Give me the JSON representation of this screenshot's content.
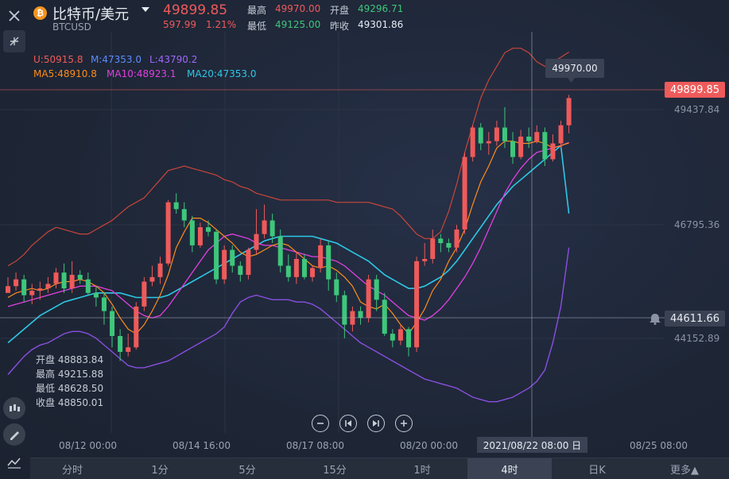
{
  "header": {
    "coin_glyph": "₿",
    "title": "比特币/美元",
    "symbol": "BTCUSD",
    "price": "49899.85",
    "change": "597.99",
    "change_pct": "1.21%",
    "high_label": "最高",
    "high_value": "49970.00",
    "open_label": "开盘",
    "open_value": "49296.71",
    "low_label": "最低",
    "low_value": "49125.00",
    "prev_label": "昨收",
    "prev_value": "49301.86"
  },
  "indicators": {
    "boll_u": "U:50915.8",
    "boll_m": "M:47353.0",
    "boll_l": "L:43790.2",
    "ma5": "MA5:48910.8",
    "ma10": "MA10:48923.1",
    "ma20": "MA20:47353.0"
  },
  "colors": {
    "up": "#ef5a5a",
    "down": "#3ec77b",
    "ma5": "#ff8c1a",
    "ma10": "#e040e0",
    "ma20": "#2ec7e6",
    "boll_u": "#c8463a",
    "boll_l": "#8a4fe0",
    "boll_m": "#4a7cff"
  },
  "y_axis": {
    "ticks": [
      "49437.84",
      "46795.36",
      "44152.89"
    ],
    "current_price_tag": "49899.85",
    "crosshair_tag": "44611.66",
    "tooltip_high": "49970.00"
  },
  "ohlc_panel": {
    "open": "开盘 48883.84",
    "high": "最高 49215.88",
    "low": "最低 48628.50",
    "close": "收盘 48850.01"
  },
  "x_axis": {
    "ticks": [
      "08/12 00:00",
      "08/14 16:00",
      "08/17 08:00",
      "08/20 00:00",
      "08/25 08:00"
    ],
    "crosshair_label": "2021/08/22 08:00 日"
  },
  "tabs": [
    "分时",
    "1分",
    "5分",
    "15分",
    "1时",
    "4时",
    "日K",
    "更多▲"
  ],
  "active_tab": "4时",
  "icons": [
    "close-icon",
    "collapse-icon",
    "candle-style-icon",
    "draw-pen-icon",
    "indicator-icon",
    "zoom-out-icon",
    "first-page-icon",
    "last-page-icon",
    "zoom-in-icon",
    "bell-icon"
  ],
  "chart_data": {
    "type": "candlestick",
    "ylim": [
      43300,
      51100
    ],
    "candles": [
      [
        45600,
        45750,
        45700,
        45950
      ],
      [
        45750,
        45900,
        45650,
        46050
      ],
      [
        45900,
        45550,
        45400,
        46000
      ],
      [
        45550,
        45650,
        45350,
        45800
      ],
      [
        45650,
        45700,
        45450,
        45850
      ],
      [
        45700,
        45800,
        45600,
        45950
      ],
      [
        45800,
        46050,
        45700,
        46150
      ],
      [
        46050,
        45700,
        45600,
        46250
      ],
      [
        45700,
        46000,
        45600,
        46300
      ],
      [
        46000,
        45900,
        45800,
        46100
      ],
      [
        45900,
        45600,
        45550,
        46050
      ],
      [
        45600,
        45500,
        45300,
        45750
      ],
      [
        45500,
        45200,
        44900,
        45600
      ],
      [
        45200,
        44650,
        44400,
        45300
      ],
      [
        44650,
        44300,
        44100,
        44800
      ],
      [
        44300,
        44400,
        44200,
        44700
      ],
      [
        44400,
        45300,
        44350,
        45400
      ],
      [
        45300,
        45850,
        45200,
        45950
      ],
      [
        45850,
        45950,
        45750,
        46200
      ],
      [
        45950,
        46250,
        45800,
        46400
      ],
      [
        46250,
        47600,
        46200,
        47650
      ],
      [
        47600,
        47450,
        47350,
        47800
      ],
      [
        47450,
        47200,
        47050,
        47600
      ],
      [
        47200,
        46650,
        46500,
        47300
      ],
      [
        46650,
        47050,
        46600,
        47150
      ],
      [
        47050,
        46950,
        46850,
        47200
      ],
      [
        46950,
        45900,
        45800,
        47000
      ],
      [
        45900,
        46550,
        45800,
        46650
      ],
      [
        46550,
        46200,
        46050,
        46650
      ],
      [
        46200,
        46000,
        45850,
        46300
      ],
      [
        46000,
        46550,
        45900,
        46600
      ],
      [
        46550,
        46900,
        46450,
        47450
      ],
      [
        46900,
        47200,
        46800,
        47550
      ],
      [
        47200,
        46850,
        46700,
        47350
      ],
      [
        46850,
        46200,
        46050,
        47000
      ],
      [
        46200,
        45950,
        45850,
        46450
      ],
      [
        45950,
        46350,
        45800,
        46500
      ],
      [
        46350,
        45950,
        45900,
        46450
      ],
      [
        45950,
        46150,
        45850,
        46200
      ],
      [
        46150,
        46650,
        46050,
        46800
      ],
      [
        46650,
        45900,
        45650,
        46750
      ],
      [
        45900,
        45550,
        45400,
        46050
      ],
      [
        45550,
        44900,
        44600,
        45650
      ],
      [
        44900,
        45200,
        44750,
        45300
      ],
      [
        45200,
        45050,
        44900,
        45300
      ],
      [
        45050,
        45900,
        44950,
        46000
      ],
      [
        45900,
        45450,
        45200,
        46000
      ],
      [
        45450,
        44700,
        44650,
        45600
      ],
      [
        44700,
        44550,
        44400,
        44800
      ],
      [
        44550,
        44800,
        44450,
        44900
      ],
      [
        44800,
        44400,
        44200,
        44850
      ],
      [
        44400,
        46300,
        44300,
        46400
      ],
      [
        46300,
        46350,
        46200,
        46700
      ],
      [
        46350,
        46800,
        46250,
        47000
      ],
      [
        46800,
        46700,
        46500,
        46900
      ],
      [
        46700,
        46600,
        46500,
        46800
      ],
      [
        46600,
        47000,
        46500,
        47100
      ],
      [
        47000,
        48600,
        46900,
        48700
      ],
      [
        48600,
        49250,
        48500,
        49300
      ],
      [
        49250,
        48900,
        48750,
        49350
      ],
      [
        48900,
        48950,
        48650,
        49150
      ],
      [
        48950,
        49250,
        48850,
        49400
      ],
      [
        49250,
        48950,
        48800,
        49700
      ],
      [
        48950,
        48600,
        48450,
        49150
      ],
      [
        48600,
        49050,
        48550,
        49200
      ],
      [
        49050,
        48950,
        48800,
        49250
      ],
      [
        48950,
        49150,
        48900,
        49300
      ],
      [
        49150,
        48550,
        48400,
        49250
      ],
      [
        48550,
        48900,
        48500,
        49100
      ],
      [
        48900,
        49300,
        48800,
        49400
      ],
      [
        49300,
        49900,
        49125,
        49970
      ]
    ],
    "ma5": [
      45500,
      45600,
      45650,
      45700,
      45650,
      45700,
      45800,
      45850,
      45850,
      45900,
      45850,
      45750,
      45600,
      45350,
      45050,
      44800,
      44700,
      44900,
      45200,
      45550,
      46000,
      46600,
      46950,
      47250,
      47250,
      47150,
      47000,
      46850,
      46700,
      46500,
      46400,
      46450,
      46550,
      46650,
      46700,
      46650,
      46500,
      46350,
      46200,
      46150,
      46200,
      46100,
      45950,
      45750,
      45400,
      45300,
      45250,
      45350,
      45150,
      44900,
      44700,
      44950,
      45250,
      45650,
      45900,
      46300,
      46600,
      47000,
      47550,
      48050,
      48400,
      48800,
      48950,
      48950,
      48900,
      48900,
      48950,
      48900,
      48800,
      48850,
      48910
    ],
    "ma10": [
      45300,
      45350,
      45400,
      45450,
      45500,
      45550,
      45600,
      45650,
      45700,
      45750,
      45750,
      45750,
      45700,
      45650,
      45500,
      45350,
      45200,
      45100,
      45050,
      45100,
      45300,
      45550,
      45800,
      46050,
      46300,
      46550,
      46700,
      46850,
      46900,
      46850,
      46800,
      46700,
      46650,
      46650,
      46600,
      46550,
      46500,
      46450,
      46400,
      46400,
      46350,
      46300,
      46200,
      46050,
      45900,
      45750,
      45650,
      45550,
      45400,
      45250,
      45100,
      45050,
      45000,
      45100,
      45250,
      45450,
      45700,
      45950,
      46250,
      46600,
      47000,
      47400,
      47800,
      48100,
      48350,
      48550,
      48700,
      48750,
      48800,
      48850,
      48920
    ],
    "ma20": [
      44500,
      44650,
      44800,
      44950,
      45100,
      45200,
      45300,
      45400,
      45450,
      45500,
      45550,
      45600,
      45600,
      45600,
      45600,
      45550,
      45500,
      45500,
      45500,
      45500,
      45550,
      45650,
      45750,
      45850,
      45950,
      46050,
      46150,
      46250,
      46350,
      46450,
      46550,
      46650,
      46750,
      46800,
      46850,
      46850,
      46850,
      46850,
      46850,
      46800,
      46750,
      46700,
      46600,
      46500,
      46400,
      46300,
      46150,
      46000,
      45900,
      45800,
      45700,
      45700,
      45750,
      45850,
      45950,
      46100,
      46300,
      46550,
      46800,
      47050,
      47300,
      47550,
      47750,
      47950,
      48100,
      48250,
      48400,
      48550,
      48700,
      48850,
      47353
    ],
    "boll_u": [
      46200,
      46300,
      46450,
      46650,
      46800,
      46950,
      47050,
      47000,
      46950,
      46900,
      46900,
      47000,
      47100,
      47200,
      47350,
      47500,
      47600,
      47700,
      47900,
      48100,
      48300,
      48350,
      48400,
      48350,
      48300,
      48250,
      48200,
      48100,
      48050,
      47950,
      47900,
      47800,
      47750,
      47700,
      47650,
      47650,
      47650,
      47650,
      47650,
      47650,
      47650,
      47600,
      47600,
      47600,
      47600,
      47600,
      47550,
      47500,
      47450,
      47300,
      47100,
      46900,
      46800,
      46800,
      46950,
      47400,
      48000,
      48700,
      49300,
      49900,
      50300,
      50600,
      50900,
      51000,
      51000,
      50900,
      50700,
      50600,
      50700,
      50800,
      50916
    ],
    "boll_l": [
      43800,
      44000,
      44200,
      44350,
      44450,
      44500,
      44600,
      44700,
      44750,
      44750,
      44700,
      44600,
      44450,
      44300,
      44150,
      44000,
      43950,
      43950,
      44000,
      44050,
      44100,
      44200,
      44300,
      44400,
      44500,
      44600,
      44700,
      44850,
      45150,
      45400,
      45500,
      45550,
      45500,
      45450,
      45450,
      45450,
      45400,
      45400,
      45350,
      45250,
      45100,
      44950,
      44800,
      44650,
      44500,
      44400,
      44300,
      44200,
      44100,
      44000,
      43900,
      43800,
      43700,
      43650,
      43600,
      43550,
      43500,
      43400,
      43300,
      43250,
      43200,
      43200,
      43250,
      43300,
      43400,
      43500,
      43650,
      43900,
      44500,
      45300,
      46600
    ]
  }
}
